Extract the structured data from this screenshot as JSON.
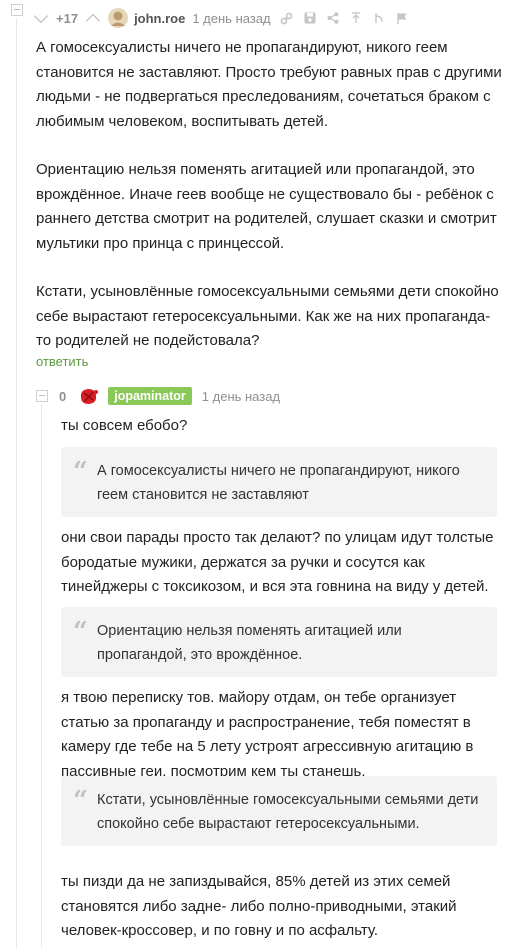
{
  "comment1": {
    "rating": "+17",
    "username": "john.roe",
    "time": "1 день назад",
    "paragraphs": [
      "А гомосексуалисты ничего не пропагандируют, никого геем становится не заставляют. Просто требуют равных прав с другими людьми - не подвергаться преследованиям, сочетаться браком с любимым человеком, воспитывать детей.",
      "Ориентацию нельзя поменять агитацией или пропагандой, это врождённое. Иначе геев вообще не существовало бы - ребёнок с раннего детства смотрит на родителей, слушает сказки и смотрит мультики про принца с принцессой.",
      "Кстати, усыновлённые гомосексуальными семьями дети спокойно себе вырастают гетеросексуальными. Как же на них пропаганда-то родителей не подейстовала?"
    ],
    "reply_label": "ответить"
  },
  "comment2": {
    "rating": "0",
    "username": "jopaminator",
    "time": "1 день назад",
    "line1": "ты совсем ебобо?",
    "quote1": "А гомосексуалисты ничего не пропагандируют, никого геем становится не заставляют",
    "text2": "они свои парады просто так делают? по улицам идут толстые бородатые мужики, держатся за ручки и сосутся как тинейджеры с токсикозом, и вся эта говнина на виду у детей.",
    "quote2": "Ориентацию нельзя поменять агитацией или пропагандой, это врождённое.",
    "text3": "я твою переписку тов. майору отдам, он тебе организует статью за пропаганду и распространение, тебя поместят в камеру где тебе на 5 лету устроят агрессивную агитацию в пассивные геи, посмотрим кем ты станешь.",
    "quote3": "Кстати, усыновлённые гомосексуальными семьями дети спокойно себе вырастают гетеросексуальными.",
    "text4": "ты пизди да не запиздывайся, 85% детей из этих семей становятся либо задне- либо полно-приводными, этакий человек-кроссовер, и по говну и по асфальту."
  }
}
